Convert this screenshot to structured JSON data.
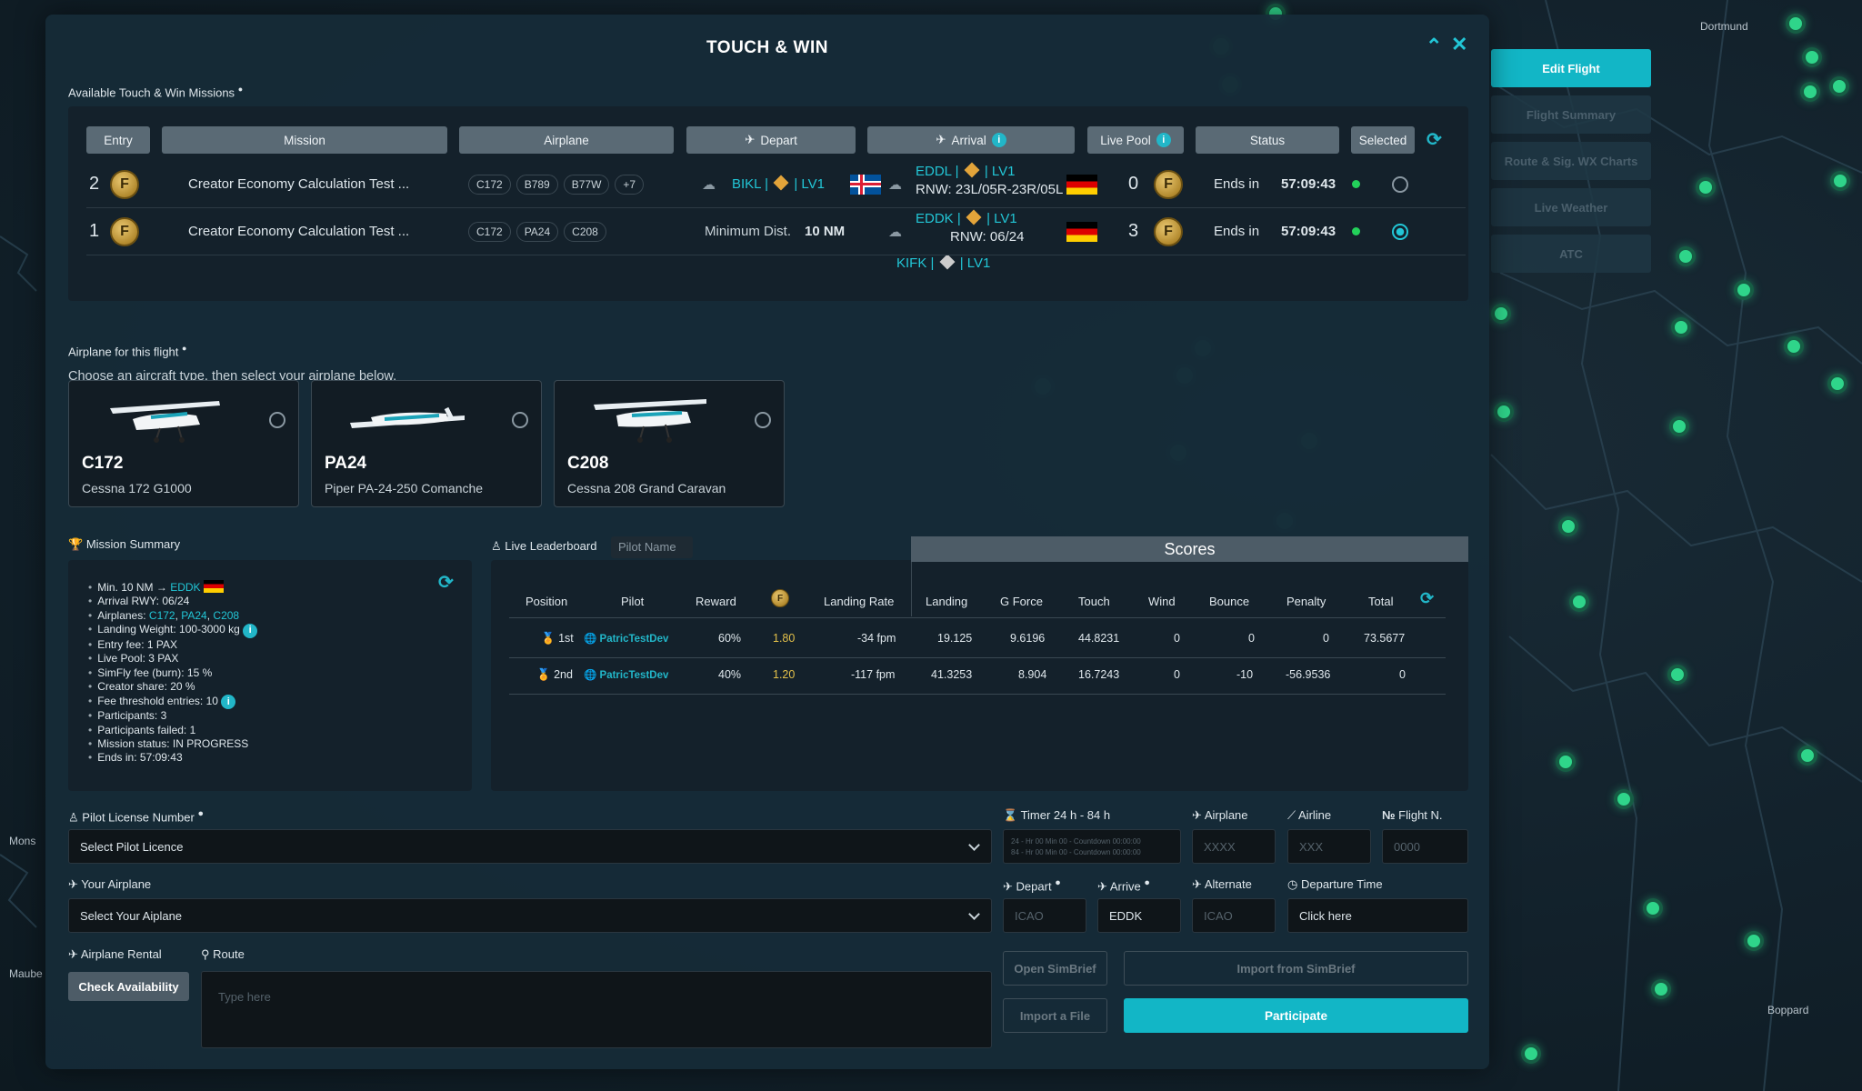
{
  "map": {
    "labels": [
      "Dortmund",
      "Mons",
      "Maube",
      "Boppard"
    ]
  },
  "modal": {
    "title": "TOUCH & WIN",
    "missions_label": "Available Touch & Win Missions",
    "missions_headers": {
      "entry": "Entry",
      "mission": "Mission",
      "airplane": "Airplane",
      "depart": "Depart",
      "arrival": "Arrival",
      "live_pool": "Live Pool",
      "status": "Status",
      "selected": "Selected"
    },
    "missions": [
      {
        "entry": "2",
        "name": "Creator Economy Calculation Test ...",
        "tags": [
          "C172",
          "B789",
          "B77W",
          "+7"
        ],
        "depart": "BIKL | ",
        "depart_lv": " | LV1",
        "arrival": "EDDL | ",
        "arrival_lv": " | LV1",
        "rnw": "RNW: 23L/05R-23R/05L",
        "pool": "0",
        "ends_label": "Ends in",
        "ends_time": "57:09:43"
      },
      {
        "entry": "1",
        "name": "Creator Economy Calculation Test ...",
        "tags": [
          "C172",
          "PA24",
          "C208"
        ],
        "min_label": "Minimum Dist.",
        "min_value": "10 NM",
        "arrival": "EDDK | ",
        "arrival_lv": " | LV1",
        "rnw": "RNW: 06/24",
        "pool": "3",
        "ends_label": "Ends in",
        "ends_time": "57:09:43"
      },
      {
        "arrival": "KIFK | ",
        "arrival_lv": " | LV1"
      }
    ],
    "airplane_label": "Airplane for this flight",
    "airplane_hint": "Choose an aircraft type, then select your airplane below.",
    "aircraft": [
      {
        "code": "C172",
        "name": "Cessna 172 G1000"
      },
      {
        "code": "PA24",
        "name": "Piper PA-24-250 Comanche"
      },
      {
        "code": "C208",
        "name": "Cessna 208 Grand Caravan"
      }
    ],
    "summary": {
      "label": "Mission Summary",
      "min_prefix": "Min. 10 NM → ",
      "min_dest": "EDDK",
      "arrival_rwy": "Arrival RWY: 06/24",
      "airplanes_prefix": "Airplanes: ",
      "airplanes": [
        "C172",
        "PA24",
        "C208"
      ],
      "landing_weight": "Landing Weight: 100-3000 kg",
      "entry_fee_prefix": "Entry fee: ",
      "entry_fee": "1 PAX",
      "live_pool_prefix": "Live Pool: ",
      "live_pool": "3 PAX",
      "simfly_prefix": "SimFly fee (burn): ",
      "simfly": "15 %",
      "creator_prefix": "Creator share: ",
      "creator": "20 %",
      "fee_threshold_prefix": "Fee threshold entries: ",
      "fee_threshold": "10",
      "participants_prefix": "Participants: ",
      "participants": "3",
      "failed_prefix": "Participants failed: ",
      "failed": "1",
      "status_prefix": "Mission status: ",
      "status": "IN PROGRESS",
      "ends_prefix": "Ends in: ",
      "ends": "57:09:43"
    },
    "leaderboard": {
      "label": "Live Leaderboard",
      "pilot_placeholder": "Pilot Name",
      "scores_label": "Scores",
      "headers": {
        "position": "Position",
        "pilot": "Pilot",
        "reward": "Reward",
        "landing_rate": "Landing Rate",
        "landing": "Landing",
        "gforce": "G Force",
        "touch": "Touch",
        "wind": "Wind",
        "bounce": "Bounce",
        "penalty": "Penalty",
        "total": "Total"
      },
      "rows": [
        {
          "pos": "1st",
          "pilot": "PatricTestDev",
          "reward": "60%",
          "coins": "1.80",
          "rate": "-34 fpm",
          "landing": "19.125",
          "gforce": "9.6196",
          "touch": "44.8231",
          "wind": "0",
          "bounce": "0",
          "penalty": "0",
          "total": "73.5677"
        },
        {
          "pos": "2nd",
          "pilot": "PatricTestDev",
          "reward": "40%",
          "coins": "1.20",
          "rate": "-117 fpm",
          "landing": "41.3253",
          "gforce": "8.904",
          "touch": "16.7243",
          "wind": "0",
          "bounce": "-10",
          "penalty": "-56.9536",
          "total": "0"
        }
      ]
    },
    "form": {
      "license_label": "Pilot License Number",
      "license_value": "Select Pilot Licence",
      "your_airplane_label": "Your Airplane",
      "your_airplane_value": "Select Your Aiplane",
      "rental_label": "Airplane Rental",
      "check_btn": "Check Availability",
      "route_label": "Route",
      "route_placeholder": "Type here",
      "timer_label": "Timer 24 h - 84 h",
      "timer_line1": "24 - Hr 00 Min 00 - Countdown 00:00:00",
      "timer_line2": "84 - Hr 00 Min 00 - Countdown 00:00:00",
      "airplane_label": "Airplane",
      "airplane_ph": "XXXX",
      "airline_label": "Airline",
      "airline_ph": "XXX",
      "flightno_label": "Flight N.",
      "flightno_ph": "0000",
      "depart_label": "Depart",
      "depart_ph": "ICAO",
      "arrive_label": "Arrive",
      "arrive_value": "EDDK",
      "alternate_label": "Alternate",
      "alternate_ph": "ICAO",
      "deptime_label": "Departure Time",
      "deptime_value": "Click here",
      "open_simbrief": "Open SimBrief",
      "import_simbrief": "Import from SimBrief",
      "import_file": "Import a File",
      "participate": "Participate"
    }
  },
  "side": [
    "Edit Flight",
    "Flight Summary",
    "Route & Sig. WX Charts",
    "Live Weather",
    "ATC"
  ]
}
